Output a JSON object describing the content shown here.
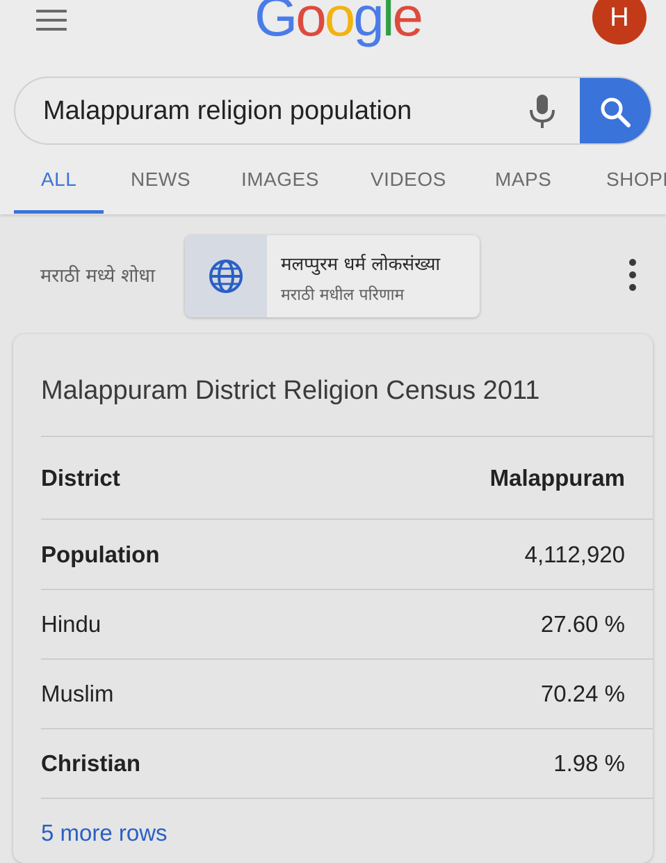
{
  "app": {
    "logo_letters": [
      {
        "char": "G",
        "color": "#4a7ce8"
      },
      {
        "char": "o",
        "color": "#dd4b3e"
      },
      {
        "char": "o",
        "color": "#f2b30f"
      },
      {
        "char": "g",
        "color": "#4a7ce8"
      },
      {
        "char": "l",
        "color": "#2f9e44"
      },
      {
        "char": "e",
        "color": "#dd4b3e"
      }
    ],
    "avatar_initial": "H",
    "accent_color": "#3a73d9"
  },
  "search": {
    "query": "Malappuram religion population",
    "mic_icon": "microphone-icon",
    "search_icon": "search-icon"
  },
  "tabs": [
    {
      "label": "ALL",
      "active": true
    },
    {
      "label": "NEWS",
      "active": false
    },
    {
      "label": "IMAGES",
      "active": false
    },
    {
      "label": "VIDEOS",
      "active": false
    },
    {
      "label": "MAPS",
      "active": false
    },
    {
      "label": "SHOPP",
      "active": false
    }
  ],
  "language_suggestion": {
    "label": "मराठी मध्ये शोधा",
    "title": "मलप्पुरम धर्म लोकसंख्या",
    "subtitle": "मराठी मधील परिणाम",
    "icon": "globe-icon"
  },
  "result_card": {
    "title": "Malappuram District Religion Census 2011",
    "rows": [
      {
        "label": "District",
        "value": "Malappuram"
      },
      {
        "label": "Population",
        "value": "4,112,920"
      },
      {
        "label": "Hindu",
        "value": "27.60 %"
      },
      {
        "label": "Muslim",
        "value": "70.24 %"
      },
      {
        "label": "Christian",
        "value": "1.98 %"
      }
    ],
    "more_rows_link": "5 more rows"
  }
}
